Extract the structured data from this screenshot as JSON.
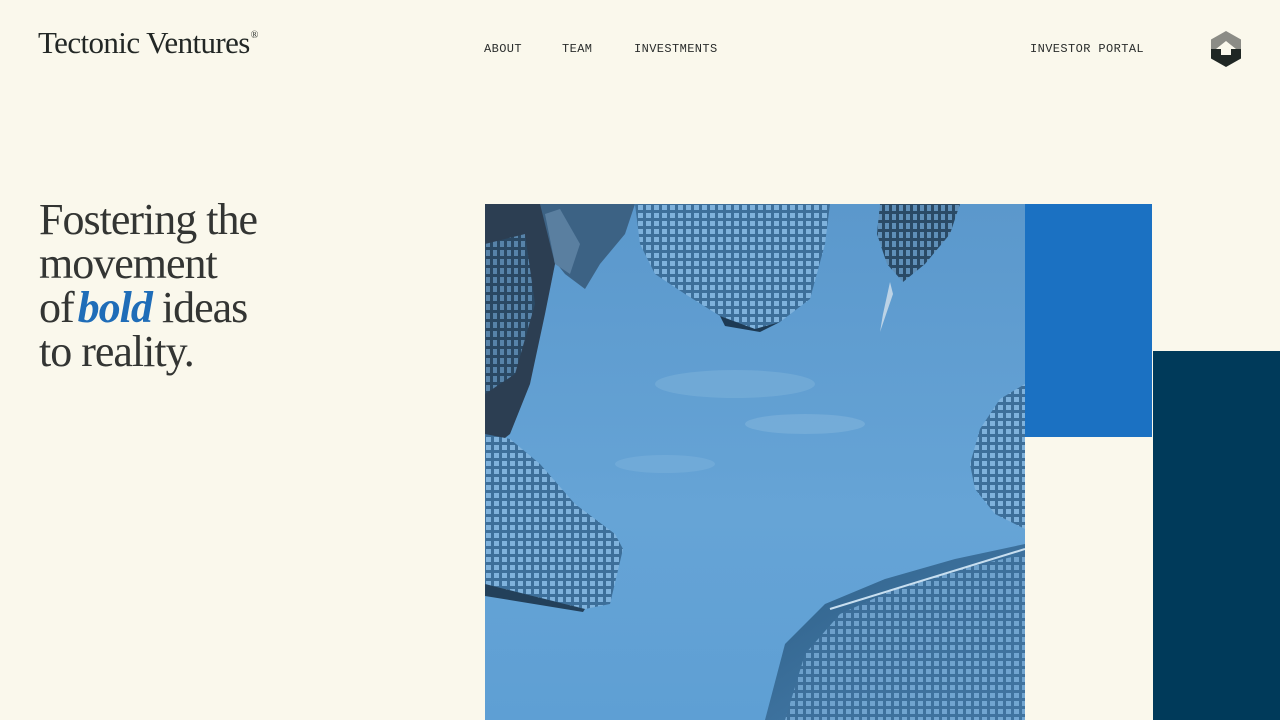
{
  "brand": {
    "name": "Tectonic Ventures",
    "registered": "®"
  },
  "nav": {
    "items": [
      {
        "label": "ABOUT"
      },
      {
        "label": "TEAM"
      },
      {
        "label": "INVESTMENTS"
      }
    ],
    "portal_label": "INVESTOR PORTAL",
    "menu_icon": "hexagon-logo-icon"
  },
  "hero": {
    "line1": "Fostering the",
    "line2": "movement",
    "line3_prefix": "of",
    "line3_emphasis": "bold",
    "line3_suffix": "ideas",
    "line4": "to reality.",
    "image_icon": "skyscrapers-looking-up-photo"
  },
  "colors": {
    "background": "#faf8ec",
    "text": "#2a2d2c",
    "accent_blue": "#1b71c2",
    "emphasis_blue": "#1f6db8",
    "navy": "#003a5a",
    "sky": "#5b9fd3"
  }
}
